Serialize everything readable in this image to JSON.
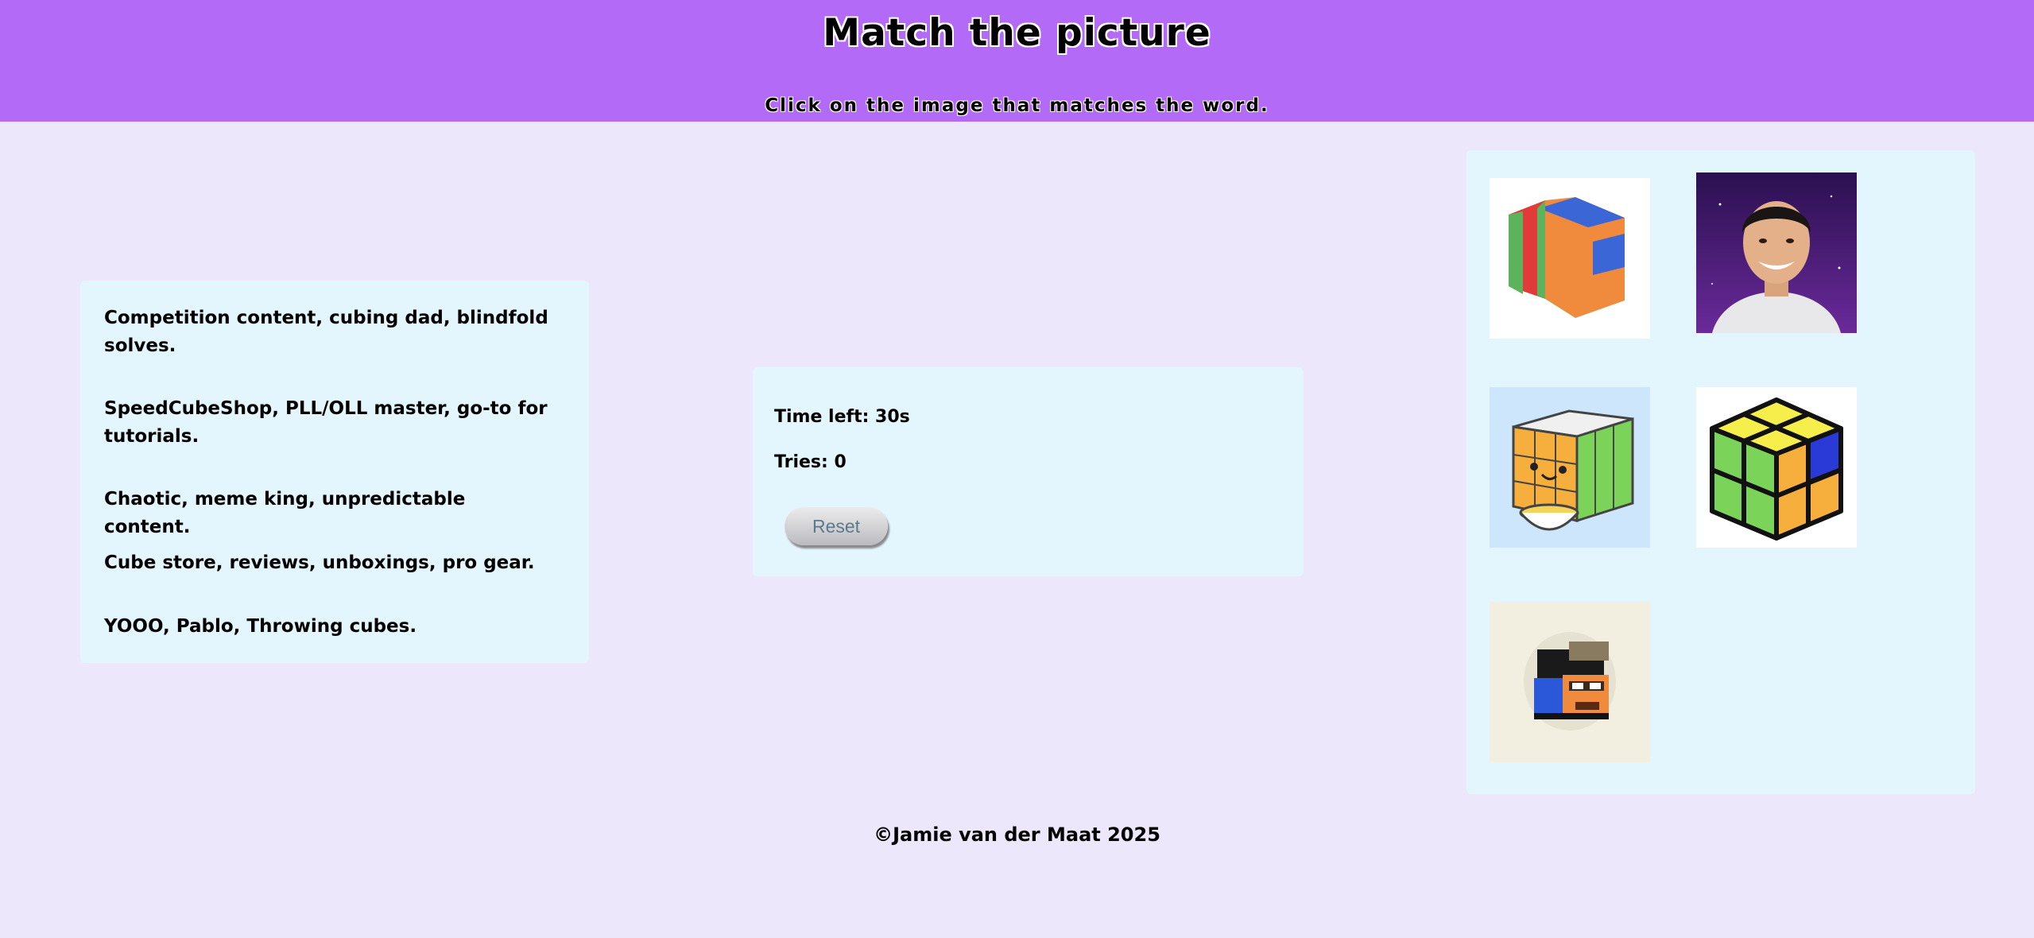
{
  "header": {
    "title": "Match the picture",
    "subtitle": "Click on the image that matches the word."
  },
  "words": [
    "Competition content, cubing dad, blindfold solves.",
    "SpeedCubeShop, PLL/OLL master, go-to for tutorials.",
    "Chaotic, meme king, unpredictable content.",
    "Cube store, reviews, unboxings, pro gear.",
    "YOOO, Pablo, Throwing cubes."
  ],
  "status": {
    "time_label": "Time left: 30s",
    "tries_label": "Tries: 0",
    "reset_label": "Reset"
  },
  "images": [
    {
      "icon": "tc-cube-logo-icon",
      "bg": "#ffffff"
    },
    {
      "icon": "smiling-man-portrait-icon",
      "bg": "#3a1a6a"
    },
    {
      "icon": "cartoon-cube-cereal-icon",
      "bg": "#cde6fb"
    },
    {
      "icon": "2x2-cube-logo-icon",
      "bg": "#ffffff"
    },
    {
      "icon": "pixel-cap-character-icon",
      "bg": "#f2efe1"
    }
  ],
  "footer": {
    "copyright": "©Jamie van der Maat 2025"
  }
}
